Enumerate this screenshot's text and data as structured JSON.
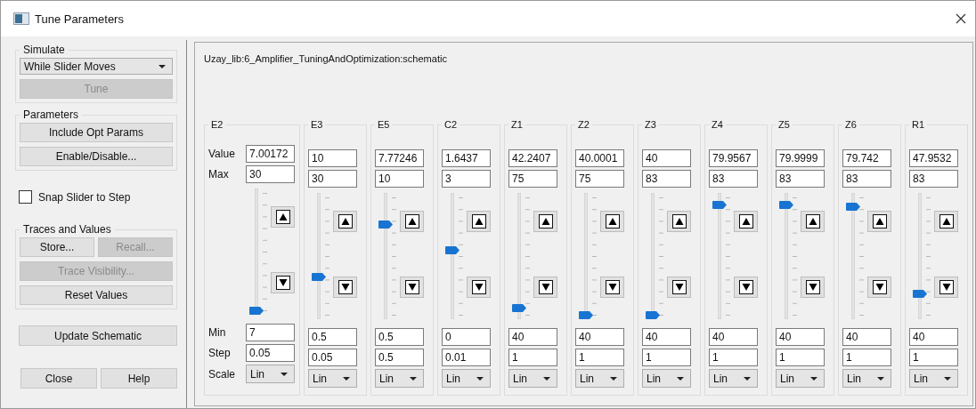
{
  "window": {
    "title": "Tune Parameters"
  },
  "simulate": {
    "label": "Simulate",
    "mode": "While Slider Moves",
    "tune_button": {
      "label": "Tune",
      "disabled": true
    }
  },
  "parameters": {
    "label": "Parameters",
    "buttons": [
      {
        "label": "Include Opt Params",
        "disabled": false
      },
      {
        "label": "Enable/Disable...",
        "disabled": false
      }
    ]
  },
  "snap": {
    "label": "Snap Slider to Step",
    "checked": false
  },
  "traces": {
    "label": "Traces and Values",
    "row": [
      {
        "label": "Store...",
        "disabled": false
      },
      {
        "label": "Recall...",
        "disabled": true
      }
    ],
    "buttons": [
      {
        "label": "Trace Visibility...",
        "disabled": true
      },
      {
        "label": "Reset Values",
        "disabled": false
      }
    ]
  },
  "update_button": {
    "label": "Update Schematic",
    "disabled": false
  },
  "footer_buttons": [
    {
      "label": "Close",
      "disabled": false
    },
    {
      "label": "Help",
      "disabled": false
    }
  ],
  "schematic": "Uzay_lib:6_Amplifier_TuningAndOptimization:schematic",
  "row_labels": {
    "value": "Value",
    "max": "Max",
    "min": "Min",
    "step": "Step",
    "scale": "Scale"
  },
  "params": [
    {
      "name": "E2",
      "value": "7.00172",
      "max": "30",
      "min": "7",
      "step": "0.05",
      "scale": "Lin",
      "level": 0
    },
    {
      "name": "E3",
      "value": "10",
      "max": "30",
      "min": "0.5",
      "step": "0.05",
      "scale": "Lin",
      "level": 0.32
    },
    {
      "name": "E5",
      "value": "7.77246",
      "max": "10",
      "min": "0.5",
      "step": "0.5",
      "scale": "Lin",
      "level": 0.77
    },
    {
      "name": "C2",
      "value": "1.6437",
      "max": "3",
      "min": "0",
      "step": "0.01",
      "scale": "Lin",
      "level": 0.55
    },
    {
      "name": "Z1",
      "value": "42.2407",
      "max": "75",
      "min": "40",
      "step": "1",
      "scale": "Lin",
      "level": 0.06
    },
    {
      "name": "Z2",
      "value": "40.0001",
      "max": "75",
      "min": "40",
      "step": "1",
      "scale": "Lin",
      "level": 0
    },
    {
      "name": "Z3",
      "value": "40",
      "max": "83",
      "min": "40",
      "step": "1",
      "scale": "Lin",
      "level": 0
    },
    {
      "name": "Z4",
      "value": "79.9567",
      "max": "83",
      "min": "40",
      "step": "1",
      "scale": "Lin",
      "level": 0.93
    },
    {
      "name": "Z5",
      "value": "79.9999",
      "max": "83",
      "min": "40",
      "step": "1",
      "scale": "Lin",
      "level": 0.93
    },
    {
      "name": "Z6",
      "value": "79.742",
      "max": "83",
      "min": "40",
      "step": "1",
      "scale": "Lin",
      "level": 0.92
    },
    {
      "name": "R1",
      "value": "47.9532",
      "max": "83",
      "min": "40",
      "step": "1",
      "scale": "Lin",
      "level": 0.18
    }
  ]
}
